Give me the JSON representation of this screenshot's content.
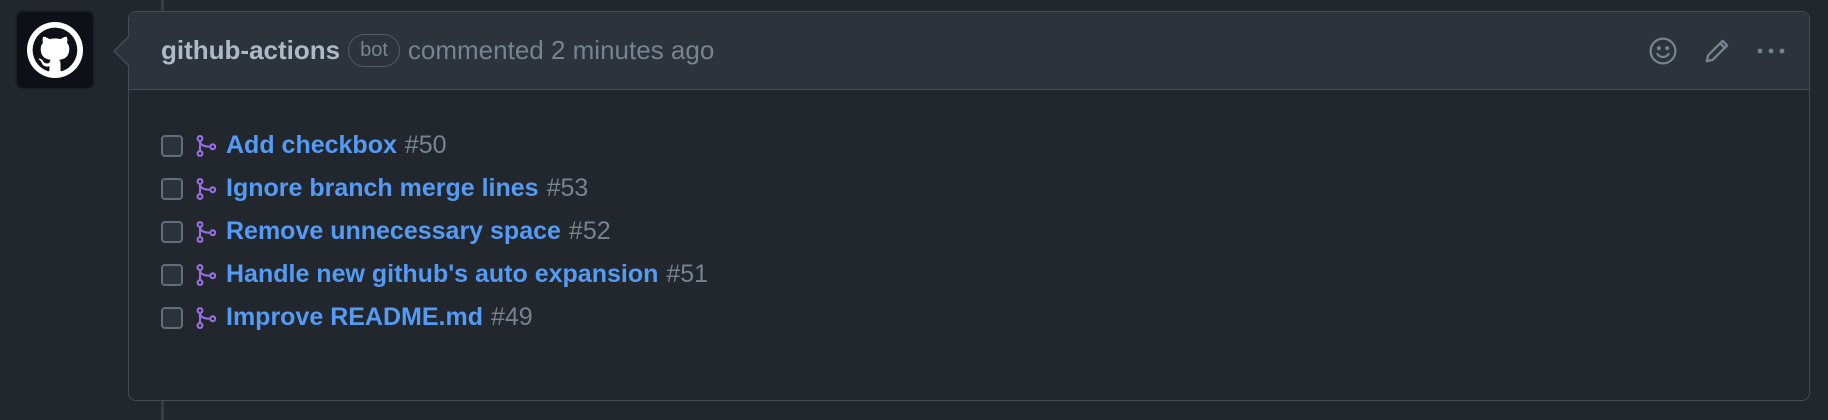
{
  "comment": {
    "author": "github-actions",
    "badge": "bot",
    "action_text": "commented 2 minutes ago",
    "avatar_icon": "github-octocat-icon",
    "header_icons": [
      "smiley-icon",
      "pencil-icon",
      "kebab-menu-icon"
    ]
  },
  "tasks": [
    {
      "title": "Add checkbox",
      "number": "#50",
      "checked": false,
      "icon": "merged-pr-icon"
    },
    {
      "title": "Ignore branch merge lines",
      "number": "#53",
      "checked": false,
      "icon": "merged-pr-icon"
    },
    {
      "title": "Remove unnecessary space",
      "number": "#52",
      "checked": false,
      "icon": "merged-pr-icon"
    },
    {
      "title": "Handle new github's auto expansion",
      "number": "#51",
      "checked": false,
      "icon": "merged-pr-icon"
    },
    {
      "title": "Improve README.md",
      "number": "#49",
      "checked": false,
      "icon": "merged-pr-icon"
    }
  ],
  "colors": {
    "background": "#22272e",
    "header_bg": "#2d333b",
    "link": "#539bf5",
    "merged_purple": "#986ee2",
    "muted": "#768390"
  }
}
